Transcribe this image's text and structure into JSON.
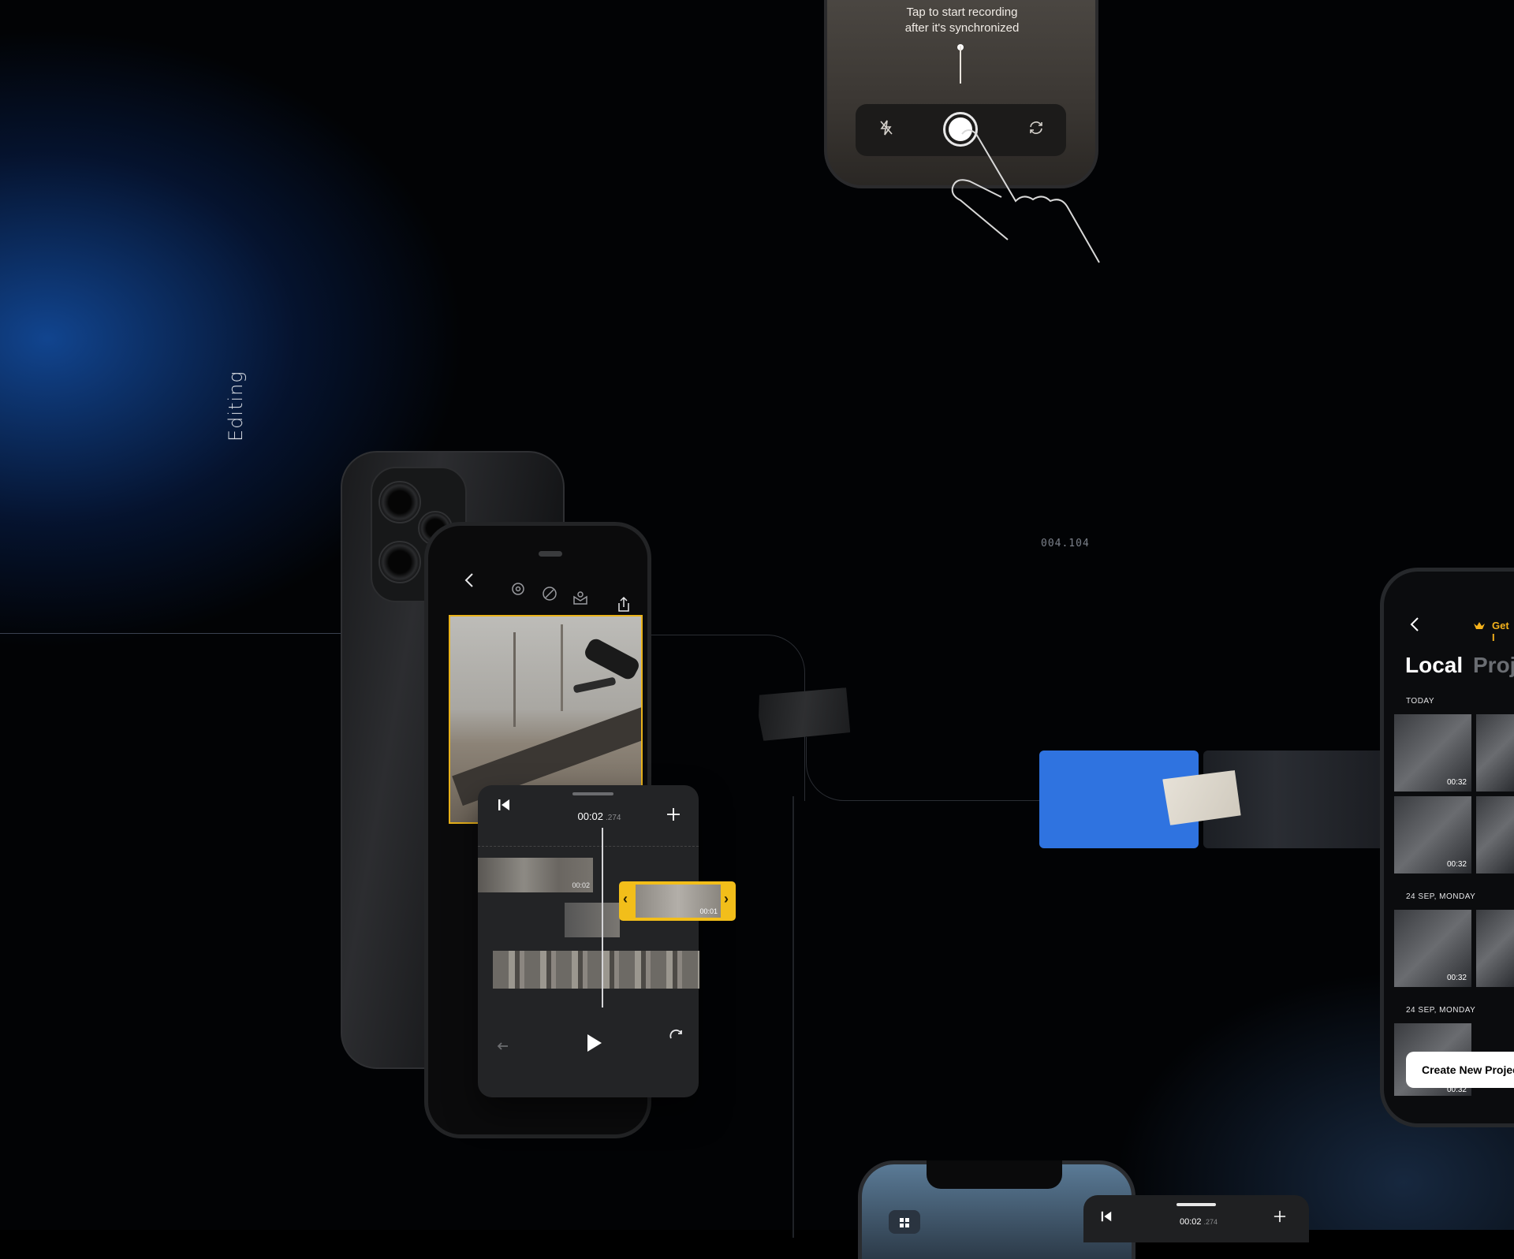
{
  "section_label": "Editing",
  "code_label": "004.104",
  "recording": {
    "hint_line1": "Tap to start recording",
    "hint_line2": "after it's synchronized",
    "flash_icon": "⚡︎",
    "flip_icon": "⟳"
  },
  "editor": {
    "toolbar_icons": [
      "back-icon",
      "settings-icon",
      "filter-icon",
      "sticker-icon",
      "share-icon"
    ],
    "time_main": "00:02",
    "time_ms": ".274",
    "clip1_time": "00:02",
    "clip2_time": "00:01",
    "accent": "#f2be1a"
  },
  "library": {
    "get_label": "Get I",
    "tabs": [
      "Local",
      "Proj"
    ],
    "sections": [
      {
        "title": "TODAY",
        "items": [
          "00:32",
          "00:32"
        ]
      },
      {
        "title": "24 SEP, MONDAY",
        "items": [
          "00:32"
        ]
      },
      {
        "title": "24 SEP, MONDAY",
        "items": [
          "00:32"
        ]
      }
    ],
    "create_button": "Create New Projec"
  },
  "bottom_editor": {
    "time_main": "00:02",
    "time_ms": ".274"
  },
  "colors": {
    "accent_blue": "#2f73e0",
    "accent_yellow": "#f2be1a",
    "crown": "#f5b21c"
  }
}
